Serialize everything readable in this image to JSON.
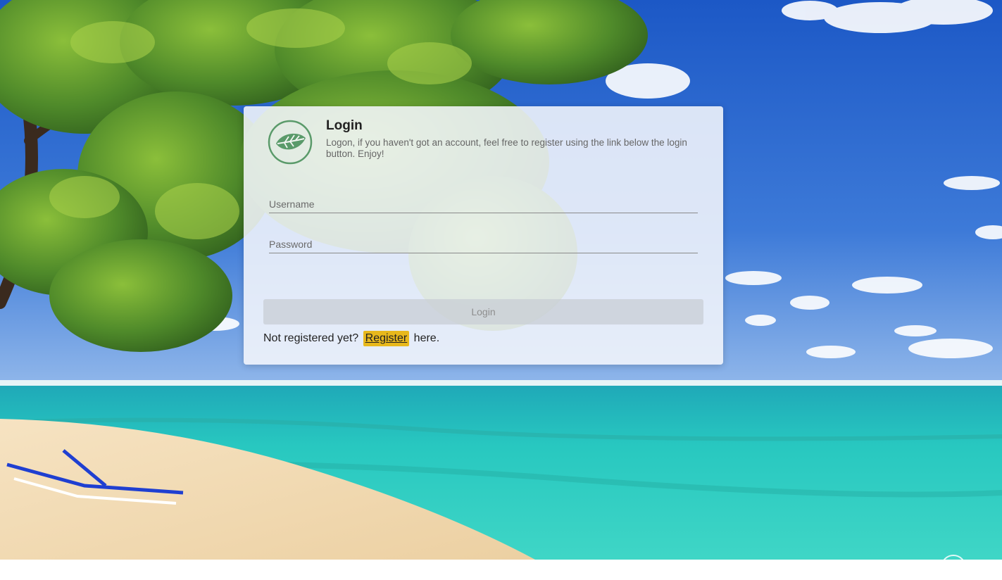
{
  "login_card": {
    "title": "Login",
    "subtitle": "Logon, if you haven't got an account, feel free to register using the link below the login button. Enjoy!",
    "logo_icon": "leaf-icon",
    "username": {
      "placeholder": "Username",
      "value": ""
    },
    "password": {
      "placeholder": "Password",
      "value": ""
    },
    "login_button": {
      "label": "Login",
      "state": "disabled"
    },
    "register": {
      "prefix": "Not registered yet?",
      "link_label": "Register",
      "suffix": "here."
    }
  },
  "background": {
    "description_icon": "beach-scene",
    "colors": {
      "sky": "#1f5fc7",
      "sea": "#27c9c0",
      "sand": "#f3ddb8",
      "foliage": "#4f8a2a",
      "register_highlight": "#e8b81c",
      "logo_green": "#5a9a6a"
    }
  }
}
